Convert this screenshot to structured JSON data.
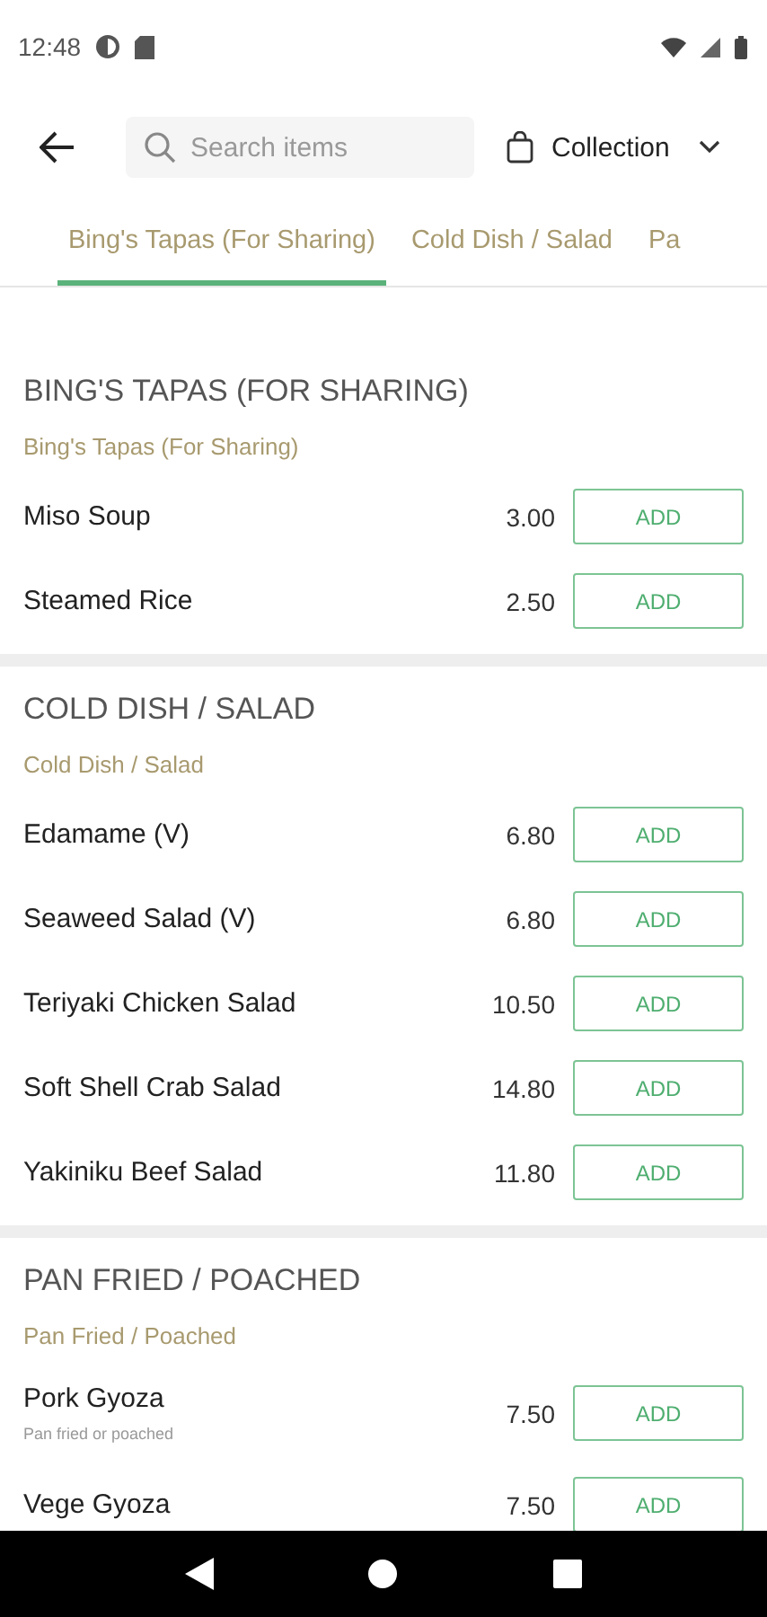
{
  "status_bar": {
    "time": "12:48"
  },
  "header": {
    "search": {
      "placeholder": "Search items"
    },
    "mode": "Collection"
  },
  "tabs": [
    {
      "label": "Bing's Tapas (For Sharing)",
      "selected": true
    },
    {
      "label": "Cold Dish / Salad",
      "selected": false
    },
    {
      "label": "Pa",
      "selected": false
    }
  ],
  "sections": [
    {
      "title": "BING'S TAPAS (FOR SHARING)",
      "subtitle": "Bing's Tapas (For Sharing)",
      "items": [
        {
          "name": "Miso Soup",
          "price": "3.00",
          "button": "ADD"
        },
        {
          "name": "Steamed Rice",
          "price": "2.50",
          "button": "ADD"
        }
      ]
    },
    {
      "title": "COLD DISH / SALAD",
      "subtitle": "Cold Dish / Salad",
      "items": [
        {
          "name": "Edamame (V)",
          "price": "6.80",
          "button": "ADD"
        },
        {
          "name": "Seaweed Salad (V)",
          "price": "6.80",
          "button": "ADD"
        },
        {
          "name": "Teriyaki Chicken Salad",
          "price": "10.50",
          "button": "ADD"
        },
        {
          "name": "Soft Shell Crab Salad",
          "price": "14.80",
          "button": "ADD"
        },
        {
          "name": "Yakiniku Beef Salad",
          "price": "11.80",
          "button": "ADD"
        }
      ]
    },
    {
      "title": "PAN FRIED / POACHED",
      "subtitle": "Pan Fried / Poached",
      "items": [
        {
          "name": "Pork Gyoza",
          "description": "Pan fried or poached",
          "price": "7.50",
          "button": "ADD"
        },
        {
          "name": "Vege Gyoza",
          "price": "7.50",
          "button": "ADD"
        }
      ]
    }
  ]
}
